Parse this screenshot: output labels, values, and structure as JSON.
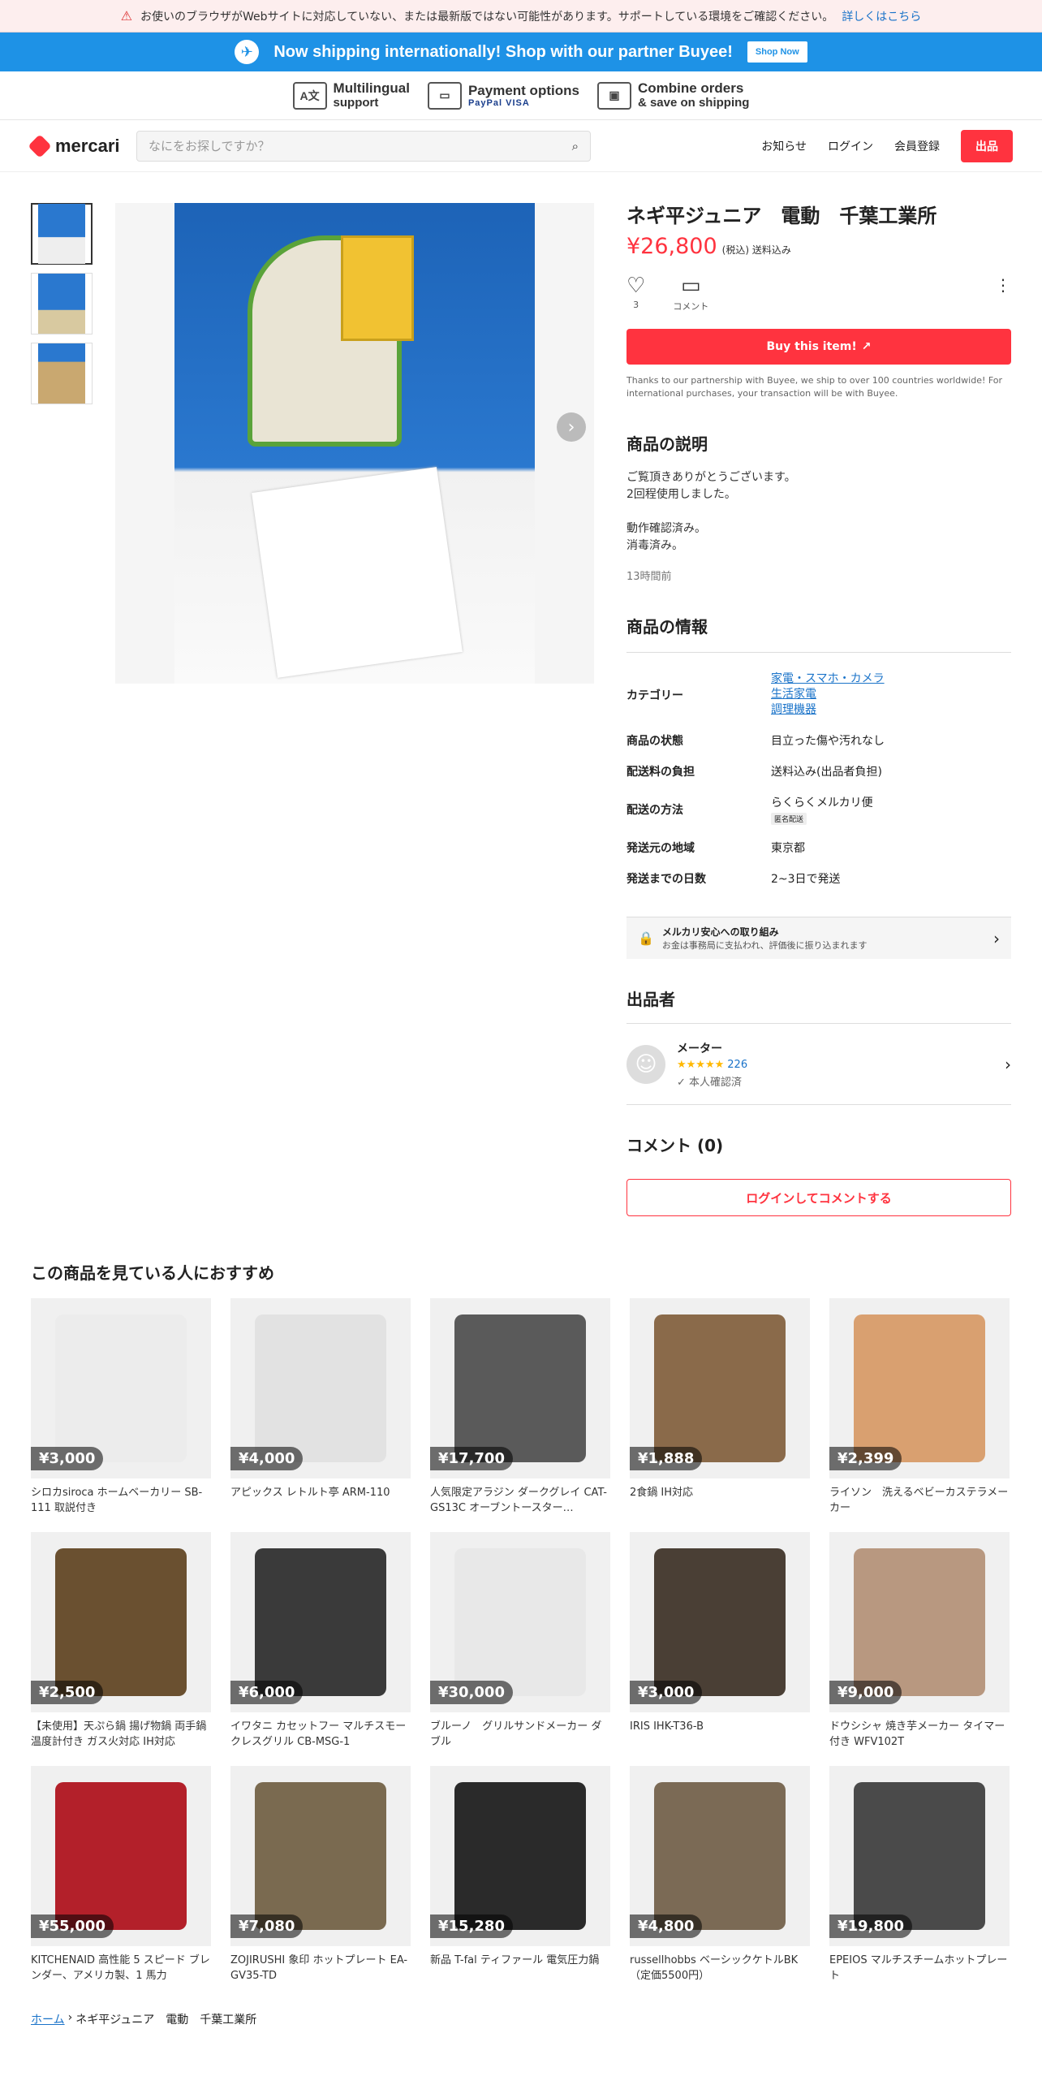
{
  "warning": {
    "text": "お使いのブラウザがWebサイトに対応していない、または最新版ではない可能性があります。サポートしている環境をご確認ください。",
    "link": "詳しくはこちら"
  },
  "banner": {
    "text": "Now shipping internationally! Shop with our partner Buyee!",
    "button": "Shop Now"
  },
  "features": [
    {
      "l1": "Multilingual",
      "l2": "support",
      "icon": "translate-icon"
    },
    {
      "l1": "Payment options",
      "l2": "PayPal VISA",
      "icon": "card-icon"
    },
    {
      "l1": "Combine orders",
      "l2": "& save on shipping",
      "icon": "box-icon"
    }
  ],
  "header": {
    "brand": "mercari",
    "search_placeholder": "なにをお探しですか？",
    "nav": [
      "お知らせ",
      "ログイン",
      "会員登録"
    ],
    "sell": "出品"
  },
  "item": {
    "title": "ネギ平ジュニア　電動　千葉工業所",
    "price": "¥26,800",
    "tax": "(税込) 送料込み",
    "likes": "3",
    "comment_label": "コメント",
    "buy": "Buy this item!",
    "note": "Thanks to our partnership with Buyee, we ship to over 100 countries worldwide! For international purchases, your transaction will be with Buyee."
  },
  "description": {
    "heading": "商品の説明",
    "lines": [
      "ご覧頂きありがとうございます。",
      "2回程使用しました。",
      "",
      "動作確認済み。",
      "消毒済み。"
    ],
    "ago": "13時間前"
  },
  "specs": {
    "heading": "商品の情報",
    "category_label": "カテゴリー",
    "categories": [
      "家電・スマホ・カメラ",
      "生活家電",
      "調理機器"
    ],
    "condition_label": "商品の状態",
    "condition": "目立った傷や汚れなし",
    "fee_label": "配送料の負担",
    "fee": "送料込み(出品者負担)",
    "method_label": "配送の方法",
    "method": "らくらくメルカリ便",
    "method_tag": "匿名配送",
    "region_label": "発送元の地域",
    "region": "東京都",
    "days_label": "発送までの日数",
    "days": "2~3日で発送"
  },
  "safe": {
    "title": "メルカリ安心への取り組み",
    "sub": "お金は事務局に支払われ、評価後に振り込まれます"
  },
  "seller": {
    "heading": "出品者",
    "name": "メーター",
    "rating_count": "226",
    "verified": "本人確認済"
  },
  "comments": {
    "heading": "コメント (0)",
    "button": "ログインしてコメントする"
  },
  "recommend": {
    "heading": "この商品を見ている人におすすめ",
    "items": [
      {
        "price": "¥3,000",
        "name": "シロカsiroca ホームベーカリー SB-111 取説付き",
        "color": "#ececec"
      },
      {
        "price": "¥4,000",
        "name": "アピックス レトルト亭 ARM-110",
        "color": "#e2e2e2"
      },
      {
        "price": "¥17,700",
        "name": "人気限定アラジン ダークグレイ CAT-GS13C オーブントースター…",
        "color": "#5a5a5a"
      },
      {
        "price": "¥1,888",
        "name": "2食鍋 IH対応",
        "color": "#8a6a4a"
      },
      {
        "price": "¥2,399",
        "name": "ライソン　洗えるベビーカステラメーカー",
        "color": "#d9a070"
      },
      {
        "price": "¥2,500",
        "name": "【未使用】天ぷら鍋 揚げ物鍋 両手鍋 温度計付き ガス火対応 IH対応",
        "color": "#6a5030"
      },
      {
        "price": "¥6,000",
        "name": "イワタニ カセットフー マルチスモークレスグリル CB-MSG-1",
        "color": "#3a3a3a"
      },
      {
        "price": "¥30,000",
        "name": "ブルーノ　グリルサンドメーカー ダブル",
        "color": "#e8e8e8"
      },
      {
        "price": "¥3,000",
        "name": "IRIS IHK-T36-B",
        "color": "#4a3f35"
      },
      {
        "price": "¥9,000",
        "name": "ドウシシャ 焼き芋メーカー タイマー付き WFV102T",
        "color": "#b89880"
      },
      {
        "price": "¥55,000",
        "name": "KITCHENAID 高性能 5 スピード ブレンダー、アメリカ製、1 馬力",
        "color": "#b3202a"
      },
      {
        "price": "¥7,080",
        "name": "ZOJIRUSHI 象印 ホットプレート EA-GV35-TD",
        "color": "#7a6a50"
      },
      {
        "price": "¥15,280",
        "name": "新品 T-fal ティファール 電気圧力鍋",
        "color": "#2a2a2a"
      },
      {
        "price": "¥4,800",
        "name": "russellhobbs ベーシックケトルBK（定価5500円）",
        "color": "#7b6a55"
      },
      {
        "price": "¥19,800",
        "name": "EPEIOS マルチスチームホットプレート",
        "color": "#4a4a4a"
      }
    ]
  },
  "breadcrumb": {
    "home": "ホーム",
    "current": "ネギ平ジュニア　電動　千葉工業所"
  }
}
